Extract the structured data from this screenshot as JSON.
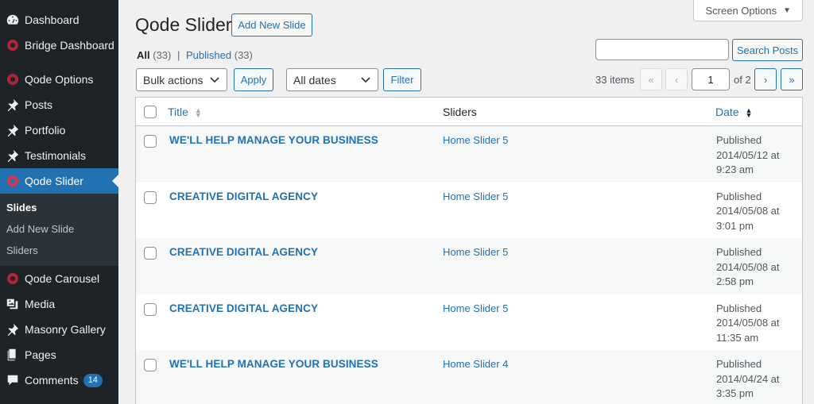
{
  "sidebar": {
    "items": [
      {
        "label": "Dashboard",
        "icon": "dashboard-icon"
      },
      {
        "label": "Bridge Dashboard",
        "icon": "qode-icon"
      },
      {
        "label": "Qode Options",
        "icon": "qode-icon"
      },
      {
        "label": "Posts",
        "icon": "pin-icon"
      },
      {
        "label": "Portfolio",
        "icon": "pin-icon"
      },
      {
        "label": "Testimonials",
        "icon": "pin-icon"
      },
      {
        "label": "Qode Slider",
        "icon": "qode-icon"
      },
      {
        "label": "Qode Carousel",
        "icon": "qode-icon"
      },
      {
        "label": "Media",
        "icon": "media-icon"
      },
      {
        "label": "Masonry Gallery",
        "icon": "pin-icon"
      },
      {
        "label": "Pages",
        "icon": "pages-icon"
      },
      {
        "label": "Comments",
        "icon": "comments-icon",
        "badge": "14"
      }
    ],
    "submenu": [
      "Slides",
      "Add New Slide",
      "Sliders"
    ]
  },
  "header": {
    "screen_options": "Screen Options",
    "title": "Qode Slider",
    "add_new": "Add New Slide"
  },
  "filters": {
    "all_label": "All",
    "all_count": "(33)",
    "separator": "|",
    "published_label": "Published",
    "published_count": "(33)"
  },
  "search": {
    "button": "Search Posts",
    "value": ""
  },
  "toolbar": {
    "bulk_actions": "Bulk actions",
    "apply": "Apply",
    "all_dates": "All dates",
    "filter": "Filter"
  },
  "pagination": {
    "items": "33 items",
    "first": "«",
    "prev": "‹",
    "current": "1",
    "of": "of 2",
    "next": "›",
    "last": "»"
  },
  "table": {
    "columns": {
      "title": "Title",
      "sliders": "Sliders",
      "date": "Date"
    },
    "rows": [
      {
        "title": "WE'LL HELP MANAGE YOUR BUSINESS",
        "slider": "Home Slider 5",
        "status": "Published",
        "date": "2014/05/12 at",
        "time": "9:23 am"
      },
      {
        "title": "CREATIVE DIGITAL AGENCY",
        "slider": "Home Slider 5",
        "status": "Published",
        "date": "2014/05/08 at",
        "time": "3:01 pm"
      },
      {
        "title": "CREATIVE DIGITAL AGENCY",
        "slider": "Home Slider 5",
        "status": "Published",
        "date": "2014/05/08 at",
        "time": "2:58 pm"
      },
      {
        "title": "CREATIVE DIGITAL AGENCY",
        "slider": "Home Slider 5",
        "status": "Published",
        "date": "2014/05/08 at",
        "time": "11:35 am"
      },
      {
        "title": "WE'LL HELP MANAGE YOUR BUSINESS",
        "slider": "Home Slider 4",
        "status": "Published",
        "date": "2014/04/24 at",
        "time": "3:35 pm"
      }
    ]
  }
}
